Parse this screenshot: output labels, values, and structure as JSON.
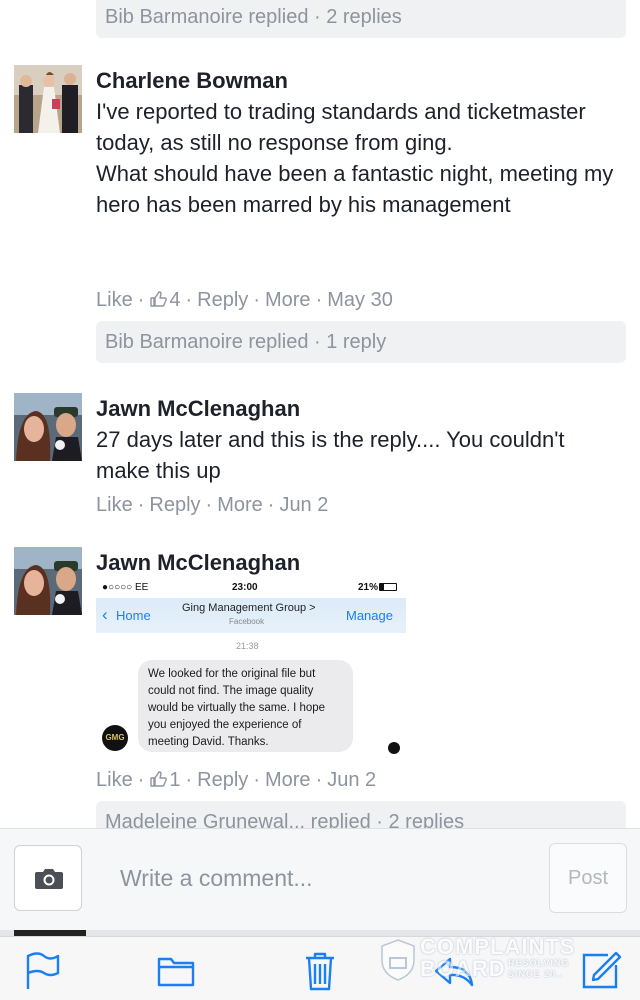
{
  "thread": {
    "top_reply_bar": "Bib Barmanoire replied · 2 replies",
    "comments": [
      {
        "author": "Charlene Bowman",
        "text_lines": [
          "I've reported to trading standards and ticketmaster today, as still no response from ging.",
          "What should have been a fantastic night, meeting my hero has been marred by his management"
        ],
        "like": "Like",
        "like_count": "4",
        "reply": "Reply",
        "more": "More",
        "date": "May 30",
        "reply_bar": "Bib Barmanoire replied · 1 reply"
      },
      {
        "author": "Jawn McClenaghan",
        "text": "27 days later and this is the reply.... You couldn't make this up",
        "like": "Like",
        "reply": "Reply",
        "more": "More",
        "date": "Jun 2"
      },
      {
        "author": "Jawn McClenaghan",
        "like": "Like",
        "like_count": "1",
        "reply": "Reply",
        "more": "More",
        "date": "Jun 2",
        "reply_bar": "Madeleine Grunewal... replied · 2 replies",
        "attachment": {
          "carrier": "●○○○○ EE",
          "time": "23:00",
          "battery": "21%",
          "back_label": "Home",
          "page_title": "Ging Management Group >",
          "page_subtitle": "Facebook",
          "action": "Manage",
          "message_time": "21:38",
          "message": "We looked for the original file but could not find. The image quality would be virtually the same. I hope you enjoyed the experience of meeting David. Thanks.",
          "sender_badge": "GMG"
        }
      }
    ]
  },
  "composer": {
    "placeholder": "Write a comment...",
    "post_label": "Post"
  },
  "toolbar": {
    "icons": [
      "flag-icon",
      "folder-icon",
      "trash-icon",
      "reply-icon",
      "compose-icon"
    ],
    "accent": "#1a7ef5"
  },
  "watermark": {
    "line1": "COMPLAINTS",
    "line2": "BOARD",
    "line3": "RESOLVING",
    "line4": "SINCE 20.."
  },
  "colors": {
    "meta_gray": "#8d949e",
    "bubble_bg": "#f0f1f3",
    "ios_blue": "#1a7ef5"
  }
}
